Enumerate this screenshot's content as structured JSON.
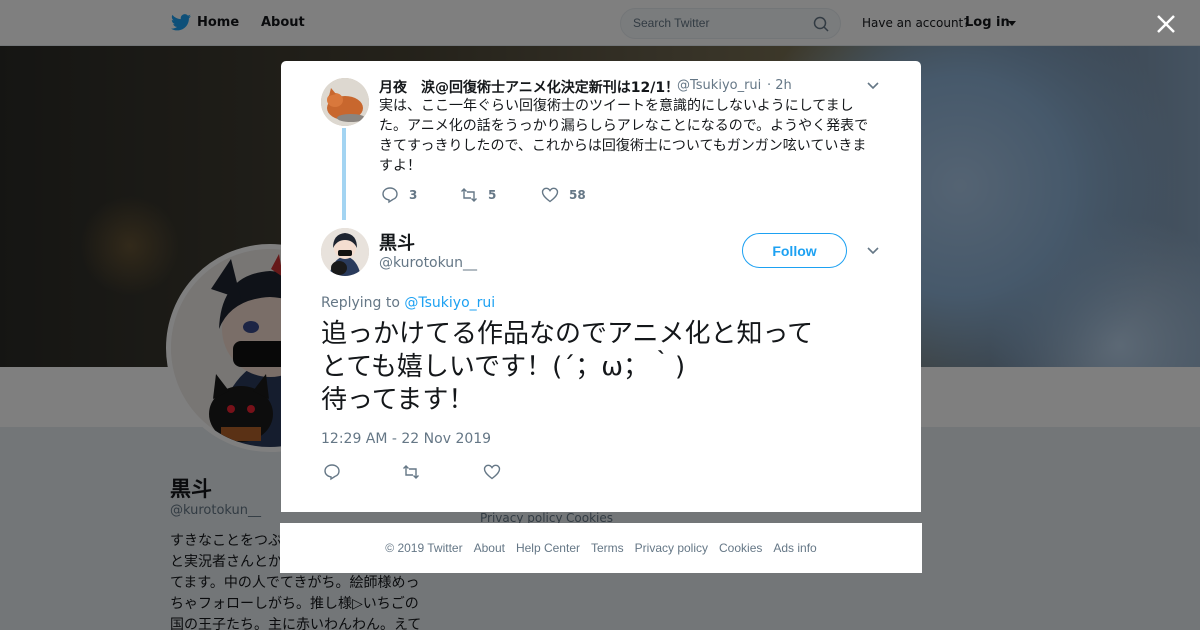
{
  "nav": {
    "home_label": "Home",
    "about_label": "About",
    "search_placeholder": "Search Twitter",
    "have_account": "Have an account?",
    "login_label": "Log in"
  },
  "profile": {
    "name": "黒斗",
    "handle": "@kurotokun__",
    "bio": "すきなことをつぶ…と実況者さんとか…てます。中の人でてきがち。絵師様めっちゃフォローしがち。推し様▷いちごの国の王子たち。主に赤いわんわん。えて",
    "bio_lines": [
      "すきなことをつぶ",
      "と実況者さんとか",
      "てます。中の人でてきがち。絵師様めっ",
      "ちゃフォローしがち。推し様▷いちごの",
      "国の王子たち。主に赤いわんわん。えて"
    ]
  },
  "sidebar": {
    "privacy": "Privacy policy",
    "cookies": "Cookies"
  },
  "parent_tweet": {
    "author_name": "月夜　涙@回復術士アニメ化決定新刊は12/1！",
    "author_handle": "@Tsukiyo_rui",
    "time": "· 2h",
    "text": "実は、ここ一年ぐらい回復術士のツイートを意識的にしないようにしてました。アニメ化の話をうっかり漏らしらアレなことになるので。ようやく発表できてすっきりしたので、これからは回復術士についてもガンガン呟いていきますよ！",
    "replies": "3",
    "retweets": "5",
    "likes": "58"
  },
  "main_tweet": {
    "author_name": "黒斗",
    "author_handle": "@kurotokun__",
    "follow_label": "Follow",
    "replying_prefix": "Replying to",
    "replying_to": "@Tsukiyo_rui",
    "text": "追っかけてる作品なのでアニメ化と知って\nとても嬉しいです！(´；ω；｀)\n待ってます！",
    "timestamp": "12:29 AM - 22 Nov 2019"
  },
  "footer": {
    "copyright": "© 2019 Twitter",
    "about": "About",
    "help": "Help Center",
    "terms": "Terms",
    "privacy": "Privacy policy",
    "cookies": "Cookies",
    "ads": "Ads info"
  },
  "colors": {
    "accent": "#1da1f2",
    "text": "#14171a",
    "muted": "#657786",
    "thread_line": "#a3d4f2"
  },
  "icons": [
    "twitter-bird-icon",
    "search-icon",
    "close-icon",
    "chevron-down-icon",
    "reply-icon",
    "retweet-icon",
    "like-icon"
  ]
}
